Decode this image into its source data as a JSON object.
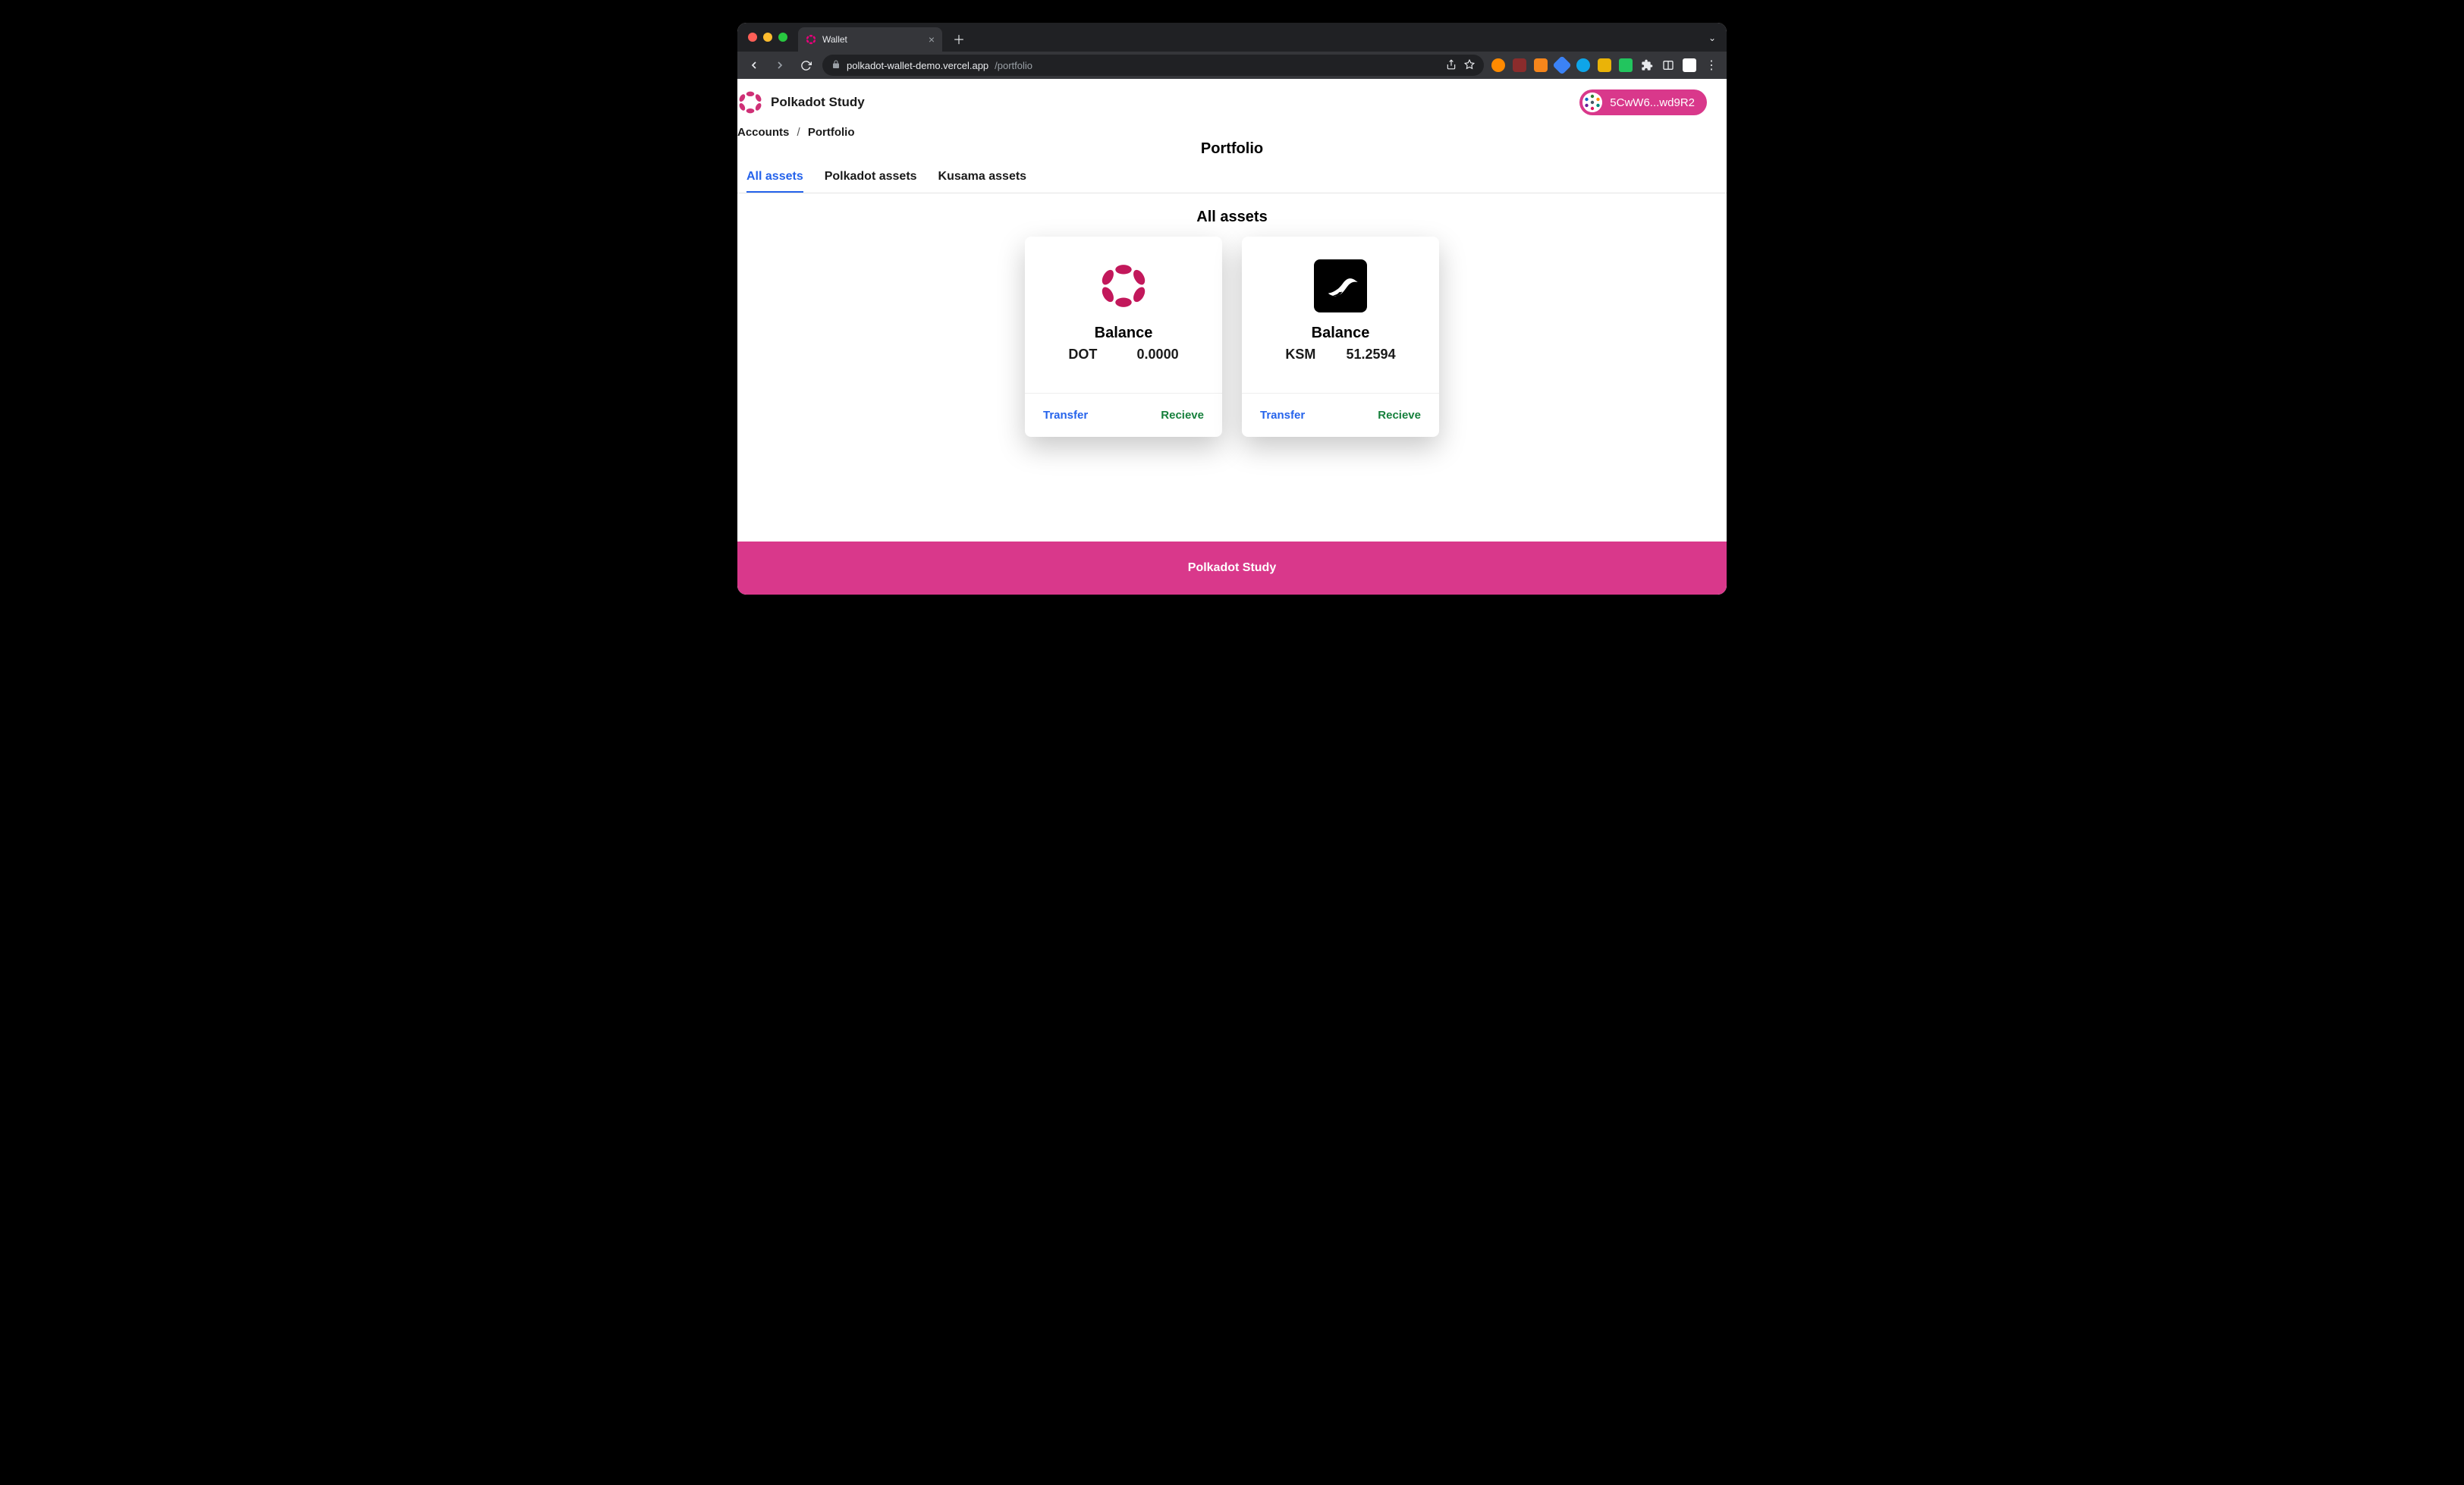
{
  "browser": {
    "tab_title": "Wallet",
    "url_host": "polkadot-wallet-demo.vercel.app",
    "url_path": "/portfolio"
  },
  "header": {
    "brand_name": "Polkadot Study"
  },
  "account": {
    "short_address": "5CwW6...wd9R2"
  },
  "breadcrumb": {
    "root": "Accounts",
    "separator": "/",
    "current": "Portfolio"
  },
  "page": {
    "title": "Portfolio",
    "section_title": "All assets"
  },
  "tabs": [
    {
      "id": "all",
      "label": "All assets",
      "active": true
    },
    {
      "id": "polkadot",
      "label": "Polkadot assets",
      "active": false
    },
    {
      "id": "kusama",
      "label": "Kusama assets",
      "active": false
    }
  ],
  "assets": [
    {
      "id": "dot",
      "symbol": "DOT",
      "balance_label": "Balance",
      "balance": "0.0000",
      "transfer_label": "Transfer",
      "receive_label": "Recieve"
    },
    {
      "id": "ksm",
      "symbol": "KSM",
      "balance_label": "Balance",
      "balance": "51.2594",
      "transfer_label": "Transfer",
      "receive_label": "Recieve"
    }
  ],
  "footer": {
    "text": "Polkadot Study"
  },
  "colors": {
    "brand_pink": "#d9388b",
    "link_blue": "#2563eb",
    "success_green": "#16803c"
  }
}
